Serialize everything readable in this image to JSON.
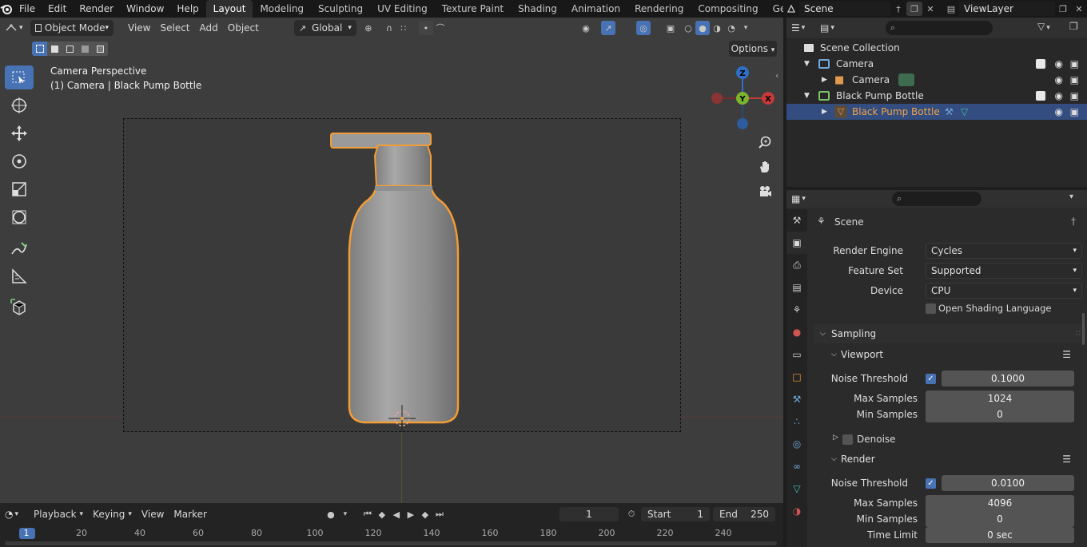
{
  "menubar": {
    "items": [
      "File",
      "Edit",
      "Render",
      "Window",
      "Help"
    ]
  },
  "workspaces": {
    "tabs": [
      "Layout",
      "Modeling",
      "Sculpting",
      "UV Editing",
      "Texture Paint",
      "Shading",
      "Animation",
      "Rendering",
      "Compositing",
      "Geometry Noc"
    ],
    "active": "Layout"
  },
  "scenebar": {
    "scene": "Scene",
    "view_layer": "ViewLayer"
  },
  "viewport": {
    "mode": "Object Mode",
    "menus": [
      "View",
      "Select",
      "Add",
      "Object"
    ],
    "transform_orientation": "Global",
    "options_label": "Options",
    "info_line1": "Camera Perspective",
    "info_line2": "(1) Camera | Black Pump Bottle",
    "gizmo": {
      "z": "Z",
      "y": "Y",
      "x": "X"
    },
    "colors": {
      "background": "#3d3d3d",
      "selection_outline": "#f29d35",
      "active_tool": "#4772b3"
    }
  },
  "timeline": {
    "menus": [
      "Playback",
      "Keying",
      "View",
      "Marker"
    ],
    "current_frame": "1",
    "start_label": "Start",
    "start": "1",
    "end_label": "End",
    "end": "250",
    "ruler": [
      "1",
      "20",
      "40",
      "60",
      "80",
      "100",
      "120",
      "140",
      "160",
      "180",
      "200",
      "220",
      "240"
    ]
  },
  "outliner": {
    "root": "Scene Collection",
    "rows": [
      {
        "label": "Camera",
        "kind": "collection"
      },
      {
        "label": "Camera",
        "kind": "camera-object"
      },
      {
        "label": "Black Pump Bottle",
        "kind": "collection"
      },
      {
        "label": "Black Pump Bottle",
        "kind": "mesh-object",
        "selected": true
      }
    ]
  },
  "properties": {
    "context": "Scene",
    "render_engine_label": "Render Engine",
    "render_engine": "Cycles",
    "feature_set_label": "Feature Set",
    "feature_set": "Supported",
    "device_label": "Device",
    "device": "CPU",
    "osl_label": "Open Shading Language",
    "sampling_label": "Sampling",
    "viewport_label": "Viewport",
    "vp_noise_label": "Noise Threshold",
    "vp_noise": "0.1000",
    "vp_max_label": "Max Samples",
    "vp_max": "1024",
    "vp_min_label": "Min Samples",
    "vp_min": "0",
    "denoise_label": "Denoise",
    "render_label": "Render",
    "r_noise_label": "Noise Threshold",
    "r_noise": "0.0100",
    "r_max_label": "Max Samples",
    "r_max": "4096",
    "r_min_label": "Min Samples",
    "r_min": "0",
    "time_limit_label": "Time Limit",
    "time_limit": "0 sec"
  }
}
